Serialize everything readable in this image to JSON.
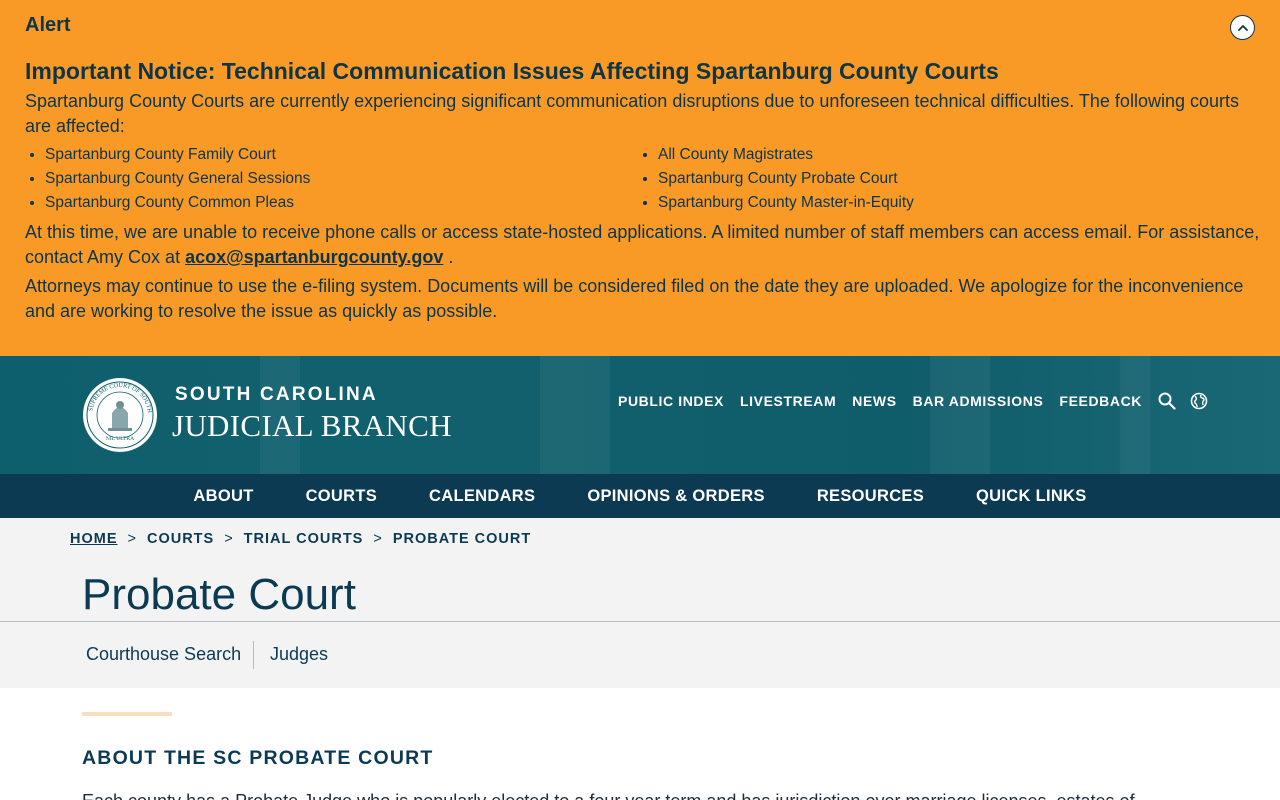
{
  "alert": {
    "label": "Alert",
    "title": "Important Notice: Technical Communication Issues Affecting Spartanburg County Courts",
    "intro": "Spartanburg County Courts are currently experiencing significant communication disruptions due to unforeseen technical difficulties. The following courts are affected:",
    "courts_left": [
      "Spartanburg County Family Court",
      "Spartanburg County General Sessions",
      "Spartanburg County Common Pleas"
    ],
    "courts_right": [
      "All County Magistrates",
      "Spartanburg County Probate Court",
      "Spartanburg County Master-in-Equity"
    ],
    "p2_text": "At this time, we are unable to receive phone calls or access state-hosted applications. A limited number of staff members can access email. For assistance, contact Amy Cox at ",
    "p2_email": "acox@spartanburgcounty.gov",
    "p2_end": " .",
    "p3": "Attorneys may continue to use the e-filing system. Documents will be considered filed on the date they are uploaded. We apologize for the inconvenience and are working to resolve the issue as quickly as possible.",
    "toggle_icon": "chevron-up-icon"
  },
  "header": {
    "brand_top": "SOUTH CAROLINA",
    "brand_bottom": "JUDICIAL BRANCH",
    "seal_text_top": "SUPREME COURT OF SOUTH CAROLINA",
    "seal_text_bottom": "NIL ULTRA",
    "utility_links": [
      "PUBLIC INDEX",
      "LIVESTREAM",
      "NEWS",
      "BAR ADMISSIONS",
      "FEEDBACK"
    ],
    "search_icon": "search-icon",
    "language_icon": "globe-icon"
  },
  "main_nav": [
    "ABOUT",
    "COURTS",
    "CALENDARS",
    "OPINIONS & ORDERS",
    "RESOURCES",
    "QUICK LINKS"
  ],
  "breadcrumb": {
    "items": [
      "HOME",
      "COURTS",
      "TRIAL COURTS",
      "PROBATE COURT"
    ],
    "separator": ">"
  },
  "page": {
    "title": "Probate Court",
    "subnav": [
      "Courthouse Search",
      "Judges"
    ],
    "section_heading": "ABOUT THE SC PROBATE COURT",
    "body_text": "Each county has a Probate Judge who is popularly elected to a four year term and has jurisdiction over marriage licenses, estates of"
  },
  "colors": {
    "alert_bg": "#f99a27",
    "navy": "#0b3a52",
    "header_teal": "#0e5f6d",
    "accent": "#f9dec0"
  }
}
